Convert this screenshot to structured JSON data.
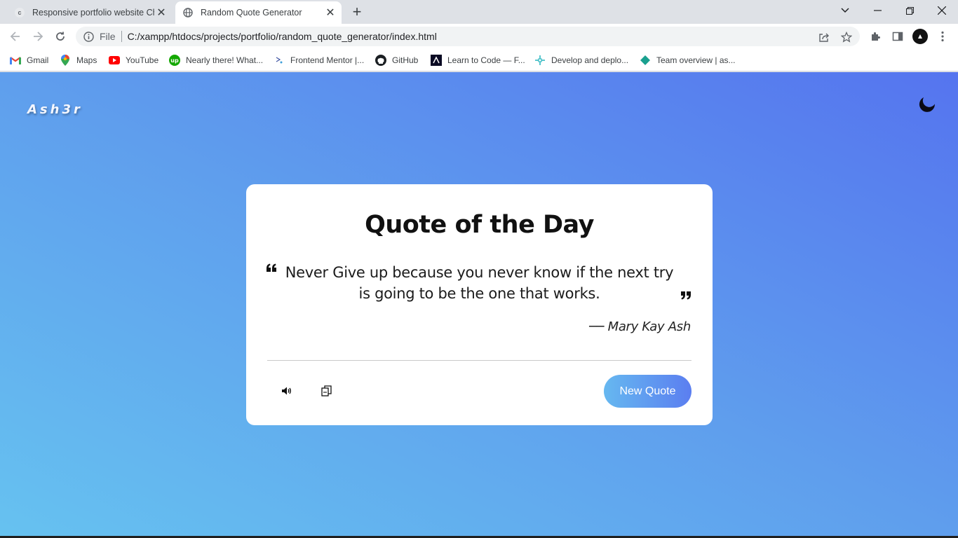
{
  "browser": {
    "tabs": [
      {
        "title": "Responsive portfolio website Chr",
        "favicon": "c",
        "active": false
      },
      {
        "title": "Random Quote Generator",
        "active": true
      }
    ],
    "address_scheme": "File",
    "url": "C:/xampp/htdocs/projects/portfolio/random_quote_generator/index.html"
  },
  "bookmarks": [
    {
      "label": "Gmail",
      "icon": "gmail-icon"
    },
    {
      "label": "Maps",
      "icon": "maps-icon"
    },
    {
      "label": "YouTube",
      "icon": "youtube-icon"
    },
    {
      "label": "Nearly there! What...",
      "icon": "upwork-icon"
    },
    {
      "label": "Frontend Mentor |...",
      "icon": "frontend-mentor-icon"
    },
    {
      "label": "GitHub",
      "icon": "github-icon"
    },
    {
      "label": "Learn to Code — F...",
      "icon": "freecodecamp-icon"
    },
    {
      "label": "Develop and deplo...",
      "icon": "deploy-icon"
    },
    {
      "label": "Team overview | as...",
      "icon": "team-icon"
    }
  ],
  "page": {
    "logo": "Ash3r",
    "theme_toggle_icon": "moon-icon",
    "card": {
      "title": "Quote of the Day",
      "quote": "Never Give up because you never know if the next try is going to be the one that works.",
      "author": "── Mary Kay Ash",
      "actions": {
        "speak_icon": "speaker-icon",
        "copy_icon": "copy-icon",
        "new_quote_label": "New Quote"
      }
    }
  },
  "colors": {
    "gradient_start": "#66c2f0",
    "gradient_end": "#5574ef",
    "card": "#ffffff"
  }
}
